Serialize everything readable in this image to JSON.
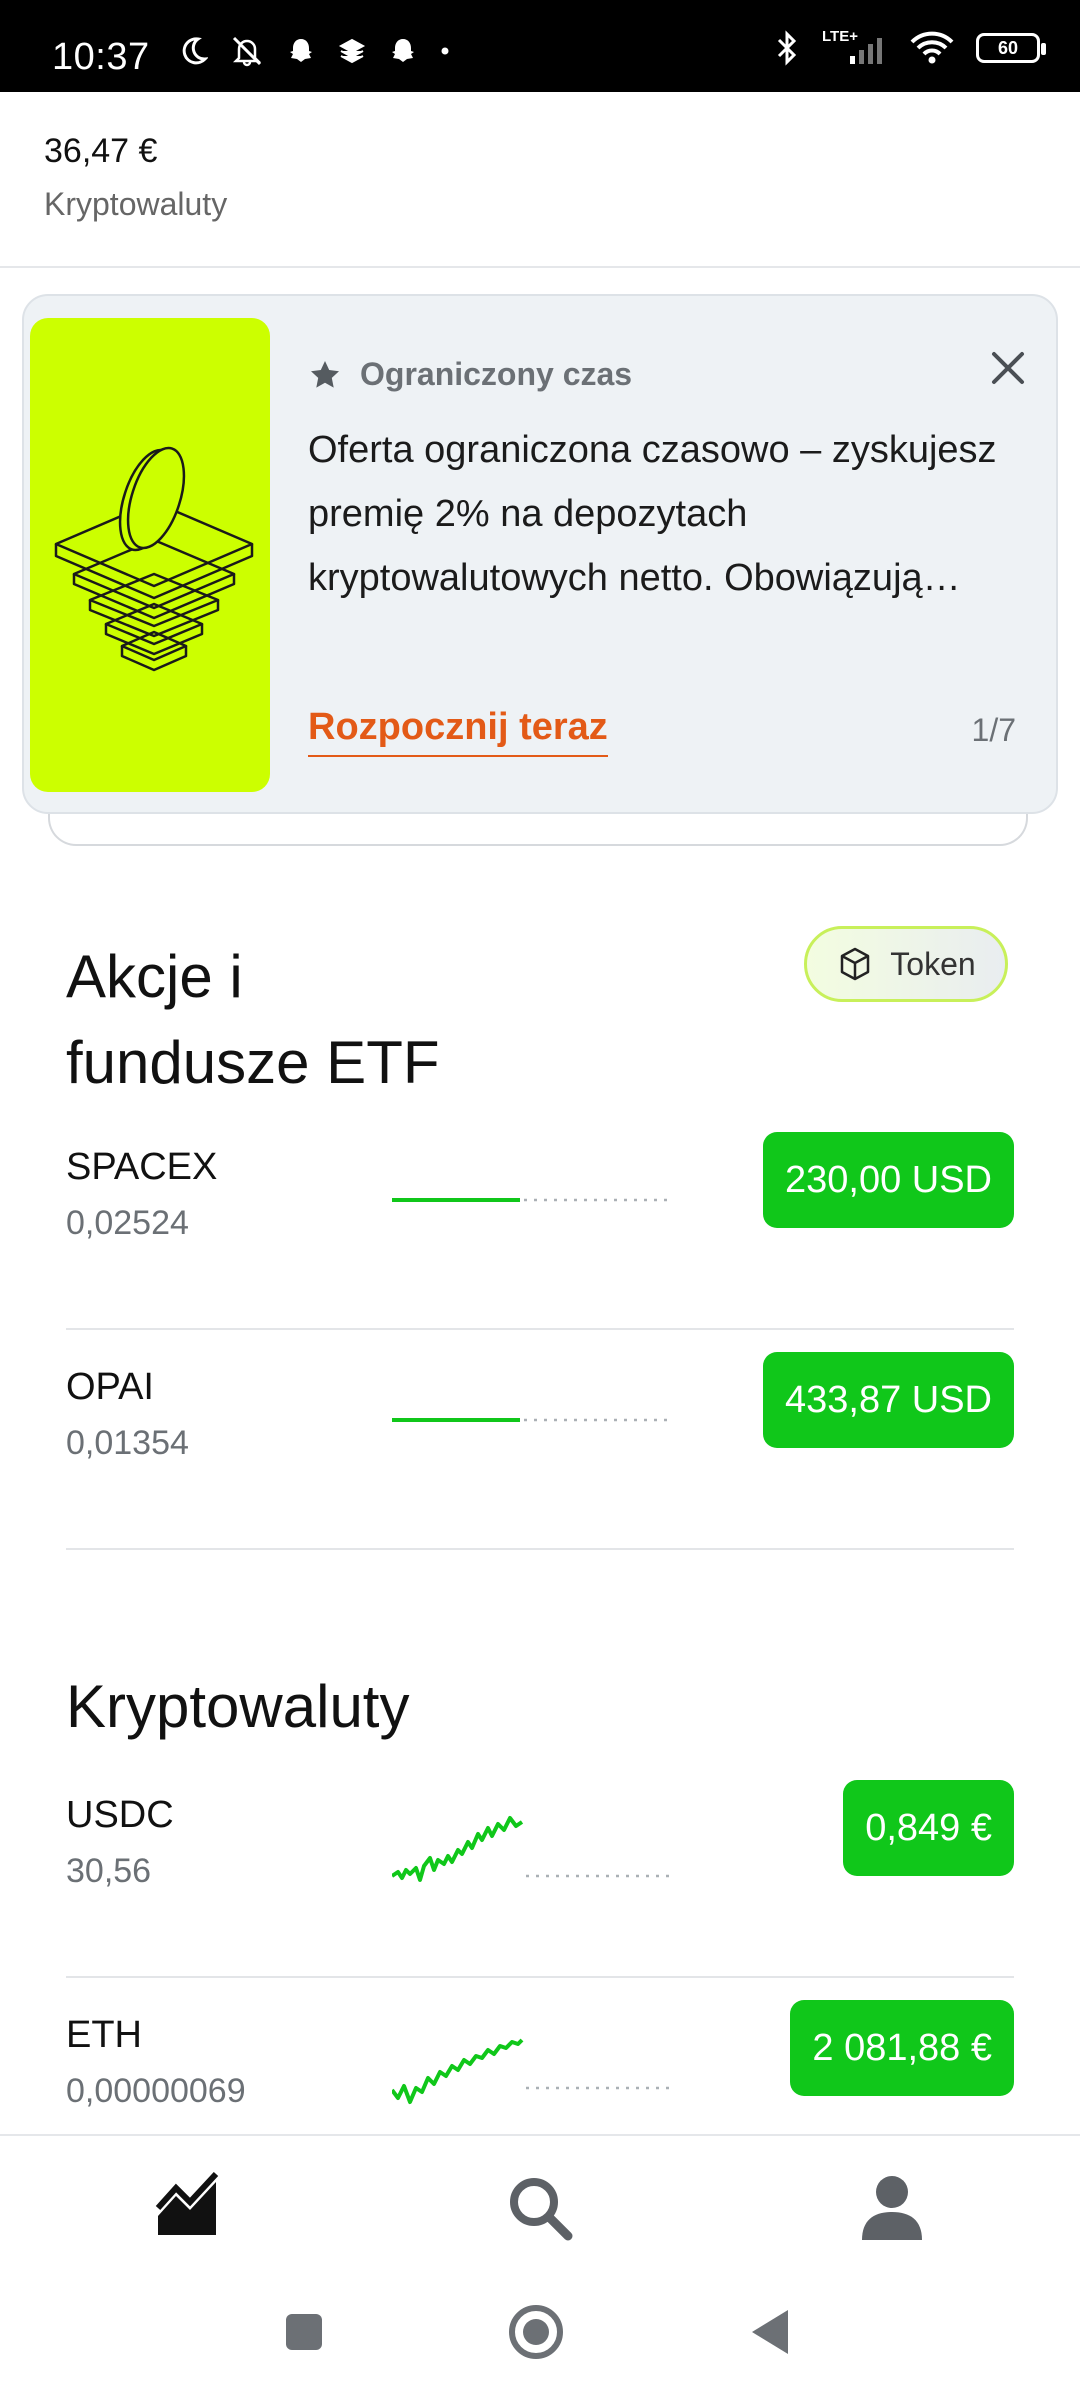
{
  "status_bar": {
    "time": "10:37",
    "network": "LTE+",
    "battery": "60"
  },
  "portfolio": {
    "value": "36,47 €",
    "label": "Kryptowaluty"
  },
  "promo": {
    "tag": "Ograniczony czas",
    "text": "Oferta ograniczona czasowo – zyskujesz premię 2% na depozytach kryptowalutowych netto. Obowiązują…",
    "cta": "Rozpocznij teraz",
    "page": "1/7",
    "image_bg": "#ccff00"
  },
  "stocks": {
    "title_line1": "Akcje i",
    "title_line2": "fundusze ETF",
    "token_chip": "Token",
    "rows": [
      {
        "name": "SPACEX",
        "qty": "0,02524",
        "price": "230,00 USD"
      },
      {
        "name": "OPAI",
        "qty": "0,01354",
        "price": "433,87 USD"
      }
    ]
  },
  "crypto": {
    "title": "Kryptowaluty",
    "rows": [
      {
        "name": "USDC",
        "qty": "30,56",
        "price": "0,849 €"
      },
      {
        "name": "ETH",
        "qty": "0,00000069",
        "price": "2 081,88 €"
      }
    ]
  },
  "colors": {
    "accent_green": "#10c71a",
    "cta_orange": "#e35a17",
    "chip_border": "#c8f05a"
  },
  "nav": {
    "items": [
      "chart-icon",
      "search-icon",
      "profile-icon"
    ]
  }
}
